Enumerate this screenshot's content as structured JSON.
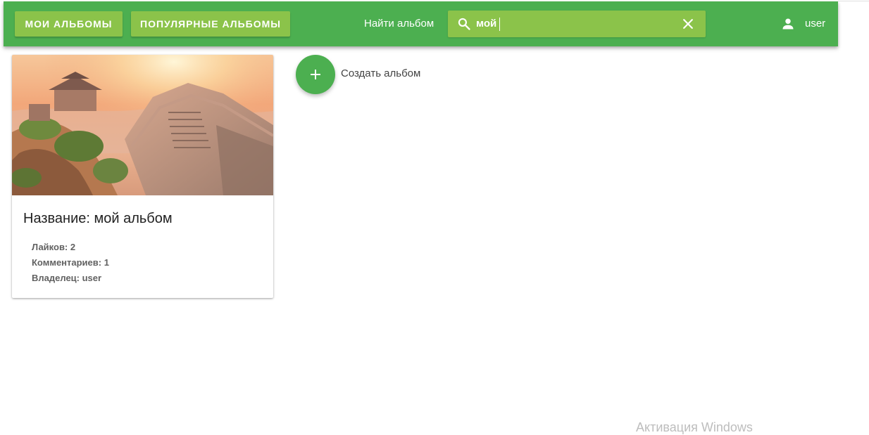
{
  "header": {
    "my_albums_label": "МОИ АЛЬБОМЫ",
    "popular_albums_label": "ПОПУЛЯРНЫЕ АЛЬБОМЫ",
    "search_label": "Найти альбом",
    "search_value": "мой",
    "search_icon": "search-icon",
    "clear_icon": "close-icon",
    "user_icon": "person-icon",
    "username": "user",
    "colors": {
      "primary": "#4caf50",
      "accent": "#8bc34a"
    }
  },
  "albums": [
    {
      "title": "Название: мой альбом",
      "likes": "Лайков: 2",
      "comments": "Комментариев: 1",
      "owner": "Владелец: user"
    }
  ],
  "create_album": {
    "icon": "plus-icon",
    "label": "Создать альбом"
  },
  "watermark": "Активация Windows"
}
